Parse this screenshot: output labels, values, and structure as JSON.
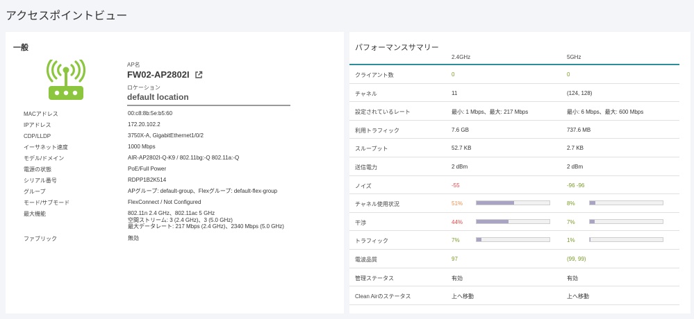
{
  "page_title": "アクセスポイントビュー",
  "general": {
    "section_title": "一般",
    "ap_name_label": "AP名",
    "ap_name": "FW02-AP2802I",
    "location_label": "ロケーション",
    "location": "default location",
    "properties": [
      {
        "key": "MACアドレス",
        "value": "00:c8:8b:5e:b5:60"
      },
      {
        "key": "IPアドレス",
        "value": "172.20.102.2"
      },
      {
        "key": "CDP/LLDP",
        "value": "3750X-A, GigabitEthernet1/0/2"
      },
      {
        "key": "イーサネット速度",
        "value": "1000 Mbps"
      },
      {
        "key": "モデル/ドメイン",
        "value": "AIR-AP2802I-Q-K9 / 802.11bg:-Q 802.11a:-Q"
      },
      {
        "key": "電源の状態",
        "value": "PoE/Full Power"
      },
      {
        "key": "シリアル番号",
        "value": "RDPP1B2K514"
      },
      {
        "key": "グループ",
        "value": "APグループ: default-group、Flexグループ: default-flex-group"
      },
      {
        "key": "モード/サブモード",
        "value": "FlexConnect / Not Configured"
      },
      {
        "key": "最大機能",
        "value": "802.11n 2.4 GHz、802.11ac 5 GHz\n空間ストリーム: 3 (2.4 GHz)、3 (5.0 GHz)\n最大データレート: 217 Mbps (2.4 GHz)、2340 Mbps (5.0 GHz)"
      },
      {
        "key": "ファブリック",
        "value": "無効"
      }
    ]
  },
  "performance": {
    "title": "パフォーマンスサマリー",
    "col_24": "2.4GHz",
    "col_5": "5GHz",
    "rows": [
      {
        "label": "クライアント数",
        "v24": "0",
        "v5": "0",
        "c24": "green",
        "c5": "green"
      },
      {
        "label": "チャネル",
        "v24": "11",
        "v5": "(124, 128)",
        "c24": "dark",
        "c5": "dark"
      },
      {
        "label": "設定されているレート",
        "v24": "最小: 1 Mbps、最大: 217 Mbps",
        "v5": "最小: 6 Mbps、最大: 600 Mbps",
        "c24": "dark",
        "c5": "dark"
      },
      {
        "label": "利用トラフィック",
        "v24": "7.6 GB",
        "v5": "737.6 MB",
        "c24": "dark",
        "c5": "dark"
      },
      {
        "label": "スループット",
        "v24": "52.7 KB",
        "v5": "2.7 KB",
        "c24": "dark",
        "c5": "dark"
      },
      {
        "label": "送信電力",
        "v24": "2 dBm",
        "v5": "2 dBm",
        "c24": "dark",
        "c5": "dark"
      },
      {
        "label": "ノイズ",
        "v24": "-55",
        "v5": "-96 -96",
        "c24": "red",
        "c5": "green"
      },
      {
        "label": "チャネル使用状況",
        "v24": "51%",
        "v5": "8%",
        "c24": "orange",
        "c5": "green",
        "bar24": 51,
        "bar5": 8
      },
      {
        "label": "干渉",
        "v24": "44%",
        "v5": "7%",
        "c24": "red",
        "c5": "green",
        "bar24": 44,
        "bar5": 7
      },
      {
        "label": "トラフィック",
        "v24": "7%",
        "v5": "1%",
        "c24": "green",
        "c5": "green",
        "bar24": 7,
        "bar5": 1
      },
      {
        "label": "電波品質",
        "v24": "97",
        "v5": "(99, 99)",
        "c24": "green",
        "c5": "green"
      },
      {
        "label": "管理ステータス",
        "v24": "有効",
        "v5": "有効",
        "c24": "dark",
        "c5": "dark"
      },
      {
        "label": "Clean Airのステータス",
        "v24": "上へ移動",
        "v5": "上へ移動",
        "c24": "dark",
        "c5": "dark"
      }
    ]
  },
  "colors": {
    "accent": "#2d8d9c",
    "icon_green": "#8cc63f",
    "bar_fill": "#a9a3c4"
  }
}
